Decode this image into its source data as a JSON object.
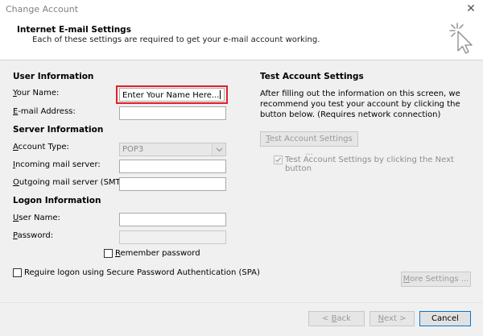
{
  "window": {
    "title": "Change Account",
    "close_glyph": "✕"
  },
  "header": {
    "title": "Internet E-mail Settings",
    "subtitle": "Each of these settings are required to get your e-mail account working."
  },
  "user_info": {
    "heading": "User Information",
    "name_label_u": "Y",
    "name_label_rest": "our Name:",
    "name_value": "Enter Your Name Here...",
    "email_label_u": "E",
    "email_label_rest": "-mail Address:",
    "email_value": ""
  },
  "server_info": {
    "heading": "Server Information",
    "account_type_label_u": "A",
    "account_type_label_rest": "ccount Type:",
    "account_type_value": "POP3",
    "incoming_label_u": "I",
    "incoming_label_rest": "ncoming mail server:",
    "incoming_value": "",
    "outgoing_label_u": "O",
    "outgoing_label_rest": "utgoing mail server (SMTP):",
    "outgoing_value": ""
  },
  "logon_info": {
    "heading": "Logon Information",
    "username_label_u": "U",
    "username_label_rest": "ser Name:",
    "username_value": "",
    "password_label_u": "P",
    "password_label_rest": "assword:",
    "password_value": "",
    "remember_label_u": "R",
    "remember_label_rest": "emember password",
    "spa_label_pre": "Re",
    "spa_label_u": "q",
    "spa_label_rest": "uire logon using Secure Password Authentication (SPA)"
  },
  "test": {
    "heading": "Test Account Settings",
    "description": "After filling out the information on this screen, we recommend you test your account by clicking the button below. (Requires network connection)",
    "test_btn_u": "T",
    "test_btn_rest": "est Account Settings ...",
    "auto_test_label": "Test Account Settings by clicking the Next button",
    "more_settings_u": "M",
    "more_settings_rest": "ore Settings ..."
  },
  "footer": {
    "back_pre": "< ",
    "back_u": "B",
    "back_rest": "ack",
    "next_u": "N",
    "next_rest": "ext >",
    "cancel_label": "Cancel"
  }
}
